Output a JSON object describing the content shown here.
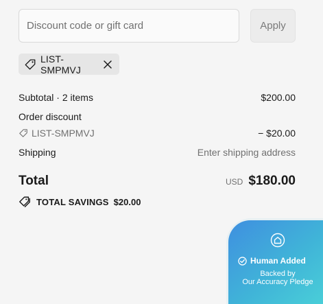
{
  "discount": {
    "placeholder": "Discount code or gift card",
    "apply_label": "Apply"
  },
  "applied_code": {
    "code": "LIST-SMPMVJ",
    "tag_icon": "tag-icon",
    "remove_icon": "close-icon"
  },
  "summary": {
    "subtotal_label": "Subtotal · 2 items",
    "subtotal_value": "$200.00",
    "order_discount_label": "Order discount",
    "discount_code": "LIST-SMPMVJ",
    "discount_value": "− $20.00",
    "shipping_label": "Shipping",
    "shipping_value": "Enter shipping address",
    "total_label": "Total",
    "currency": "USD",
    "total_value": "$180.00",
    "savings_label": "TOTAL SAVINGS",
    "savings_value": "$20.00"
  },
  "badge": {
    "title": "Human Added",
    "line1": "Backed by",
    "line2": "Our Accuracy Pledge",
    "icons": [
      "home-icon",
      "check-circle-icon"
    ]
  },
  "colors": {
    "background": "#f5f5f5",
    "chip_background": "#e6e6e6",
    "badge_gradient_start": "#3f8fe0",
    "badge_gradient_end": "#4ad0d8"
  }
}
